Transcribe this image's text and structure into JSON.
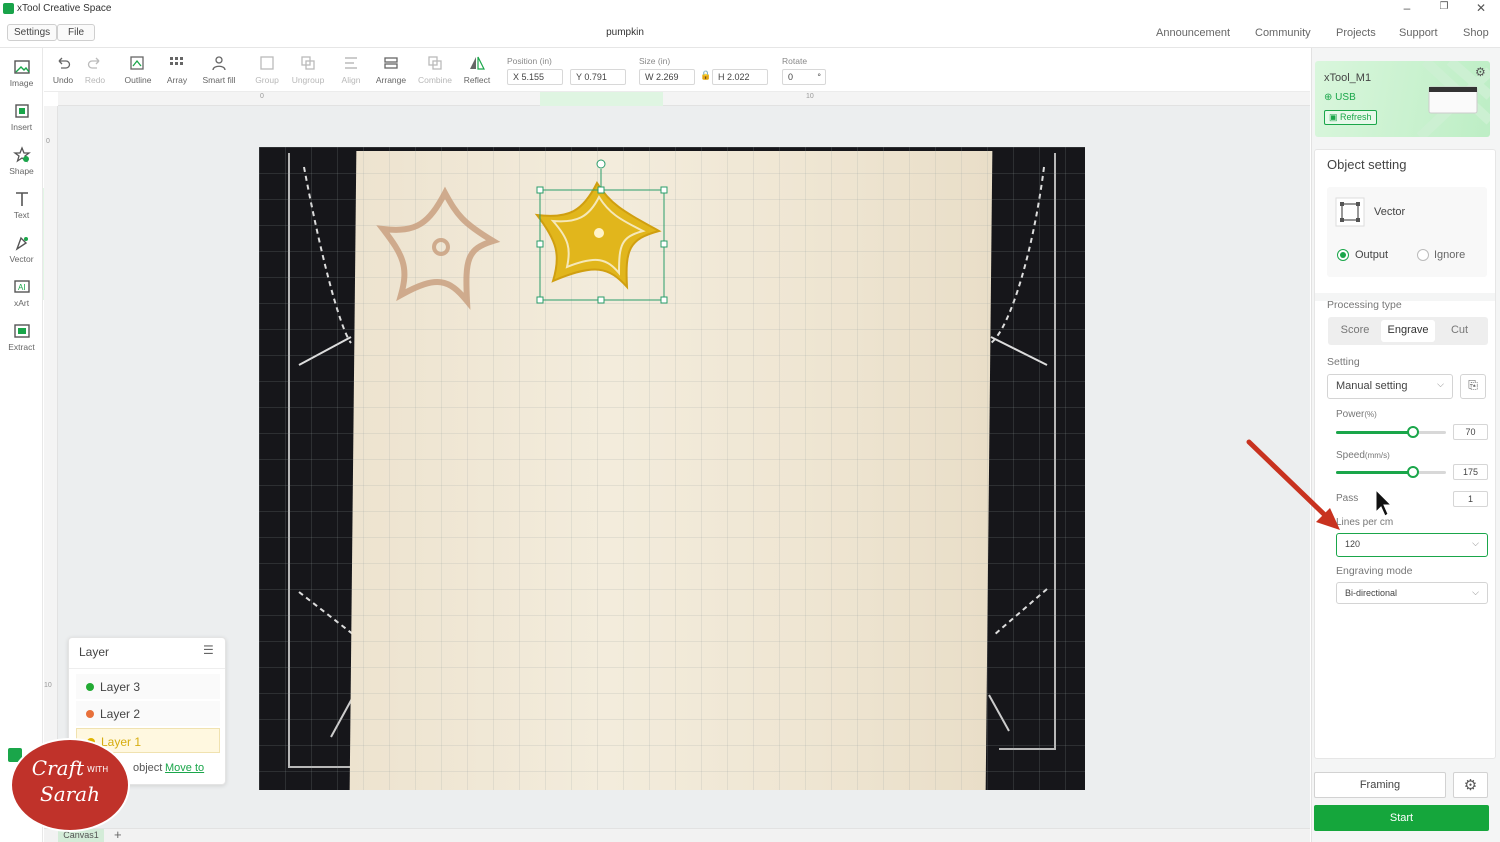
{
  "window": {
    "app_title": "xTool Creative Space"
  },
  "menubar": {
    "settings_label": "Settings",
    "file_label": "File",
    "document_title": "pumpkin",
    "nav": [
      "Announcement",
      "Community",
      "Projects",
      "Support",
      "Shop"
    ]
  },
  "left_tools": [
    "Image",
    "Insert",
    "Shape",
    "Text",
    "Vector",
    "xArt",
    "Extract"
  ],
  "toolbar": {
    "undo": "Undo",
    "redo": "Redo",
    "outline": "Outline",
    "array": "Array",
    "smart_fill": "Smart fill",
    "group": "Group",
    "ungroup": "Ungroup",
    "align": "Align",
    "arrange": "Arrange",
    "combine": "Combine",
    "reflect": "Reflect",
    "position_label": "Position (in)",
    "x_value": "X 5.155",
    "y_value": "Y 0.791",
    "size_label": "Size (in)",
    "w_value": "W 2.269",
    "h_value": "H 2.022",
    "rotate_label": "Rotate",
    "rotate_value": "0",
    "rotate_unit": "°"
  },
  "rulers": {
    "top_ticks": [
      "0",
      "10"
    ],
    "left_ticks": [
      "0",
      "10"
    ]
  },
  "device": {
    "name": "xTool_M1",
    "connection": "USB",
    "refresh_label": "Refresh"
  },
  "object_setting": {
    "title": "Object setting",
    "object_type": "Vector",
    "output_label": "Output",
    "ignore_label": "Ignore",
    "processing_type_label": "Processing type",
    "processing_types": [
      "Score",
      "Engrave",
      "Cut"
    ],
    "selected_processing": "Engrave",
    "setting_label": "Setting",
    "setting_value": "Manual setting",
    "power_label": "Power",
    "power_unit": "(%)",
    "power_value": "70",
    "power_level": 0.7,
    "speed_label": "Speed",
    "speed_unit": "(mm/s)",
    "speed_value": "175",
    "speed_level": 0.7,
    "pass_label": "Pass",
    "pass_value": "1",
    "lines_label": "Lines per cm",
    "lines_value": "120",
    "engraving_mode_label": "Engraving mode",
    "engraving_mode_value": "Bi-directional"
  },
  "actions": {
    "framing_label": "Framing",
    "start_label": "Start"
  },
  "layers": {
    "title": "Layer",
    "items": [
      {
        "name": "Layer 3",
        "color": "#22aa33"
      },
      {
        "name": "Layer 2",
        "color": "#e8703a"
      },
      {
        "name": "Layer 1",
        "color": "#e0b400"
      }
    ],
    "footer_text": "object",
    "move_to_label": "Move to"
  },
  "canvas_tab": {
    "label": "Canvas1",
    "add_label": "+"
  },
  "watermark": {
    "line1": "Craft",
    "line2": "Sarah",
    "with": "WITH"
  },
  "colors": {
    "accent": "#15a63c",
    "selection": "#2a9d6a",
    "flower_selected": "#e1b61c",
    "arrow": "#c8321f"
  }
}
